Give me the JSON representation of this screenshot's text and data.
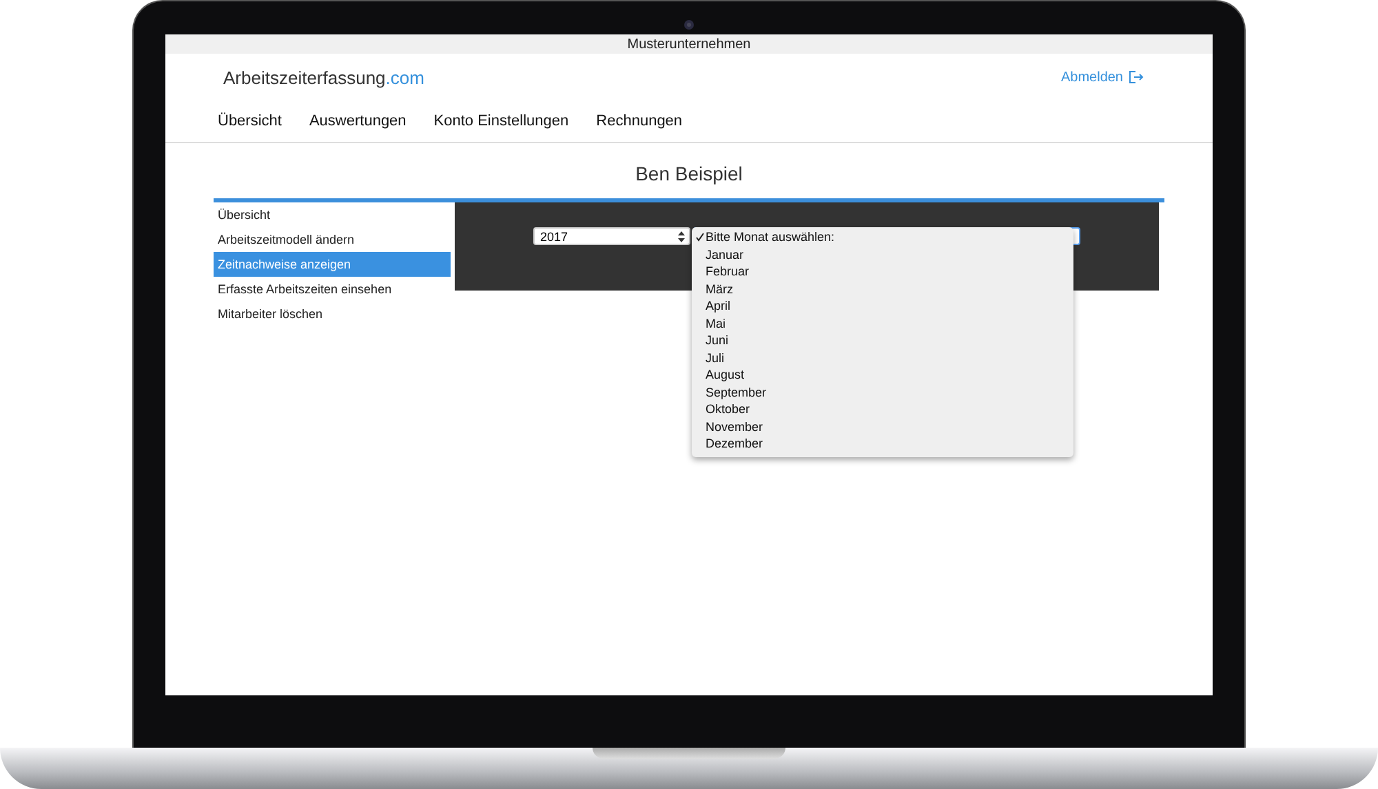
{
  "company": "Musterunternehmen",
  "logo": {
    "name": "Arbeitszeiterfassung",
    "suffix": ".com"
  },
  "logout": "Abmelden",
  "nav": [
    {
      "label": "Übersicht"
    },
    {
      "label": "Auswertungen"
    },
    {
      "label": "Konto Einstellungen"
    },
    {
      "label": "Rechnungen"
    }
  ],
  "title": "Ben Beispiel",
  "sidebar": {
    "items": [
      {
        "label": "Übersicht",
        "selected": false
      },
      {
        "label": "Arbeitszeitmodell ändern",
        "selected": false
      },
      {
        "label": "Zeitnachweise anzeigen",
        "selected": true
      },
      {
        "label": "Erfasste Arbeitszeiten einsehen",
        "selected": false
      },
      {
        "label": "Mitarbeiter löschen",
        "selected": false
      }
    ]
  },
  "year_select": {
    "value": "2017"
  },
  "month_menu": {
    "options": [
      {
        "label": "Bitte Monat auswählen:",
        "selected": true
      },
      {
        "label": "Januar",
        "selected": false
      },
      {
        "label": "Februar",
        "selected": false
      },
      {
        "label": "März",
        "selected": false
      },
      {
        "label": "April",
        "selected": false
      },
      {
        "label": "Mai",
        "selected": false
      },
      {
        "label": "Juni",
        "selected": false
      },
      {
        "label": "Juli",
        "selected": false
      },
      {
        "label": "August",
        "selected": false
      },
      {
        "label": "September",
        "selected": false
      },
      {
        "label": "Oktober",
        "selected": false
      },
      {
        "label": "November",
        "selected": false
      },
      {
        "label": "Dezember",
        "selected": false
      }
    ]
  }
}
